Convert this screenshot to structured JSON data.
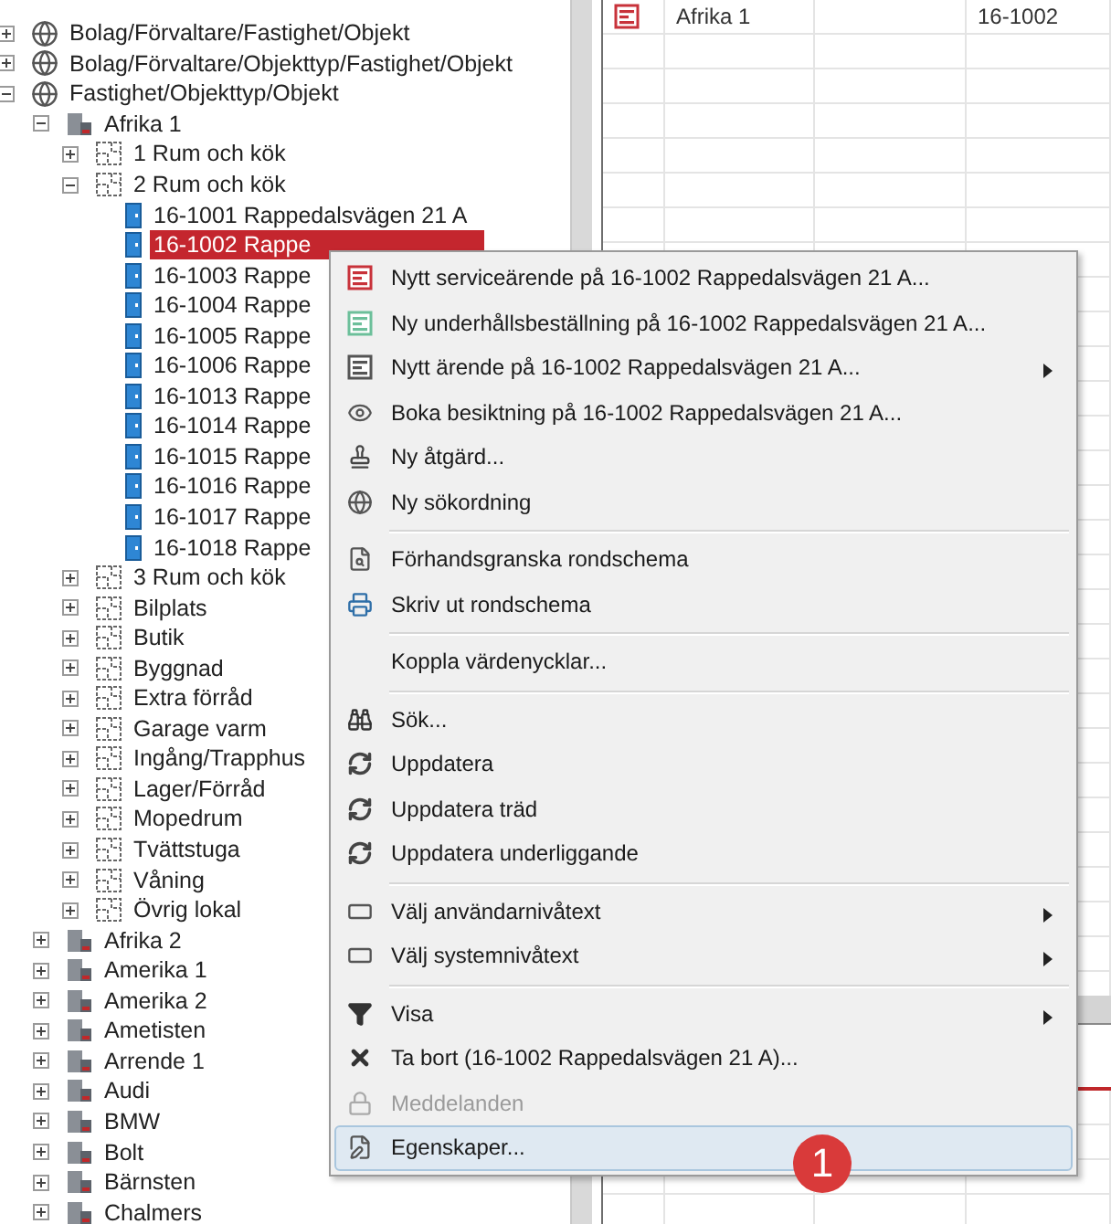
{
  "tree": [
    {
      "label": "Bolag/Förvaltare/Fastighet/Objekt",
      "kind": "query",
      "expanded": false
    },
    {
      "label": "Bolag/Förvaltare/Objekttyp/Fastighet/Objekt",
      "kind": "query",
      "expanded": false
    },
    {
      "label": "Fastighet/Objekttyp/Objekt",
      "kind": "query",
      "expanded": true,
      "children": [
        {
          "label": "Afrika 1",
          "kind": "property",
          "expanded": true,
          "children": [
            {
              "label": "1 Rum och kök",
              "kind": "objecttype",
              "expanded": false
            },
            {
              "label": "2 Rum och kök",
              "kind": "objecttype",
              "expanded": true,
              "children": [
                {
                  "label": "16-1001 Rappedalsvägen 21 A",
                  "kind": "unit",
                  "selected": false
                },
                {
                  "label": "16-1002 Rappe",
                  "kind": "unit",
                  "selected": true
                },
                {
                  "label": "16-1003 Rappe",
                  "kind": "unit",
                  "selected": false
                },
                {
                  "label": "16-1004 Rappe",
                  "kind": "unit",
                  "selected": false
                },
                {
                  "label": "16-1005 Rappe",
                  "kind": "unit",
                  "selected": false
                },
                {
                  "label": "16-1006 Rappe",
                  "kind": "unit",
                  "selected": false
                },
                {
                  "label": "16-1013 Rappe",
                  "kind": "unit",
                  "selected": false
                },
                {
                  "label": "16-1014 Rappe",
                  "kind": "unit",
                  "selected": false
                },
                {
                  "label": "16-1015 Rappe",
                  "kind": "unit",
                  "selected": false
                },
                {
                  "label": "16-1016 Rappe",
                  "kind": "unit",
                  "selected": false
                },
                {
                  "label": "16-1017 Rappe",
                  "kind": "unit",
                  "selected": false
                },
                {
                  "label": "16-1018 Rappe",
                  "kind": "unit",
                  "selected": false
                }
              ]
            },
            {
              "label": "3 Rum och kök",
              "kind": "objecttype",
              "expanded": false
            },
            {
              "label": "Bilplats",
              "kind": "objecttype",
              "expanded": false
            },
            {
              "label": "Butik",
              "kind": "objecttype",
              "expanded": false
            },
            {
              "label": "Byggnad",
              "kind": "objecttype",
              "expanded": false
            },
            {
              "label": "Extra förråd",
              "kind": "objecttype",
              "expanded": false
            },
            {
              "label": "Garage varm",
              "kind": "objecttype",
              "expanded": false
            },
            {
              "label": "Ingång/Trapphus",
              "kind": "objecttype",
              "expanded": false
            },
            {
              "label": "Lager/Förråd",
              "kind": "objecttype",
              "expanded": false
            },
            {
              "label": "Mopedrum",
              "kind": "objecttype",
              "expanded": false
            },
            {
              "label": "Tvättstuga",
              "kind": "objecttype",
              "expanded": false
            },
            {
              "label": "Våning",
              "kind": "objecttype",
              "expanded": false
            },
            {
              "label": "Övrig lokal",
              "kind": "objecttype",
              "expanded": false
            }
          ]
        },
        {
          "label": "Afrika 2",
          "kind": "property",
          "expanded": false
        },
        {
          "label": "Amerika 1",
          "kind": "property",
          "expanded": false
        },
        {
          "label": "Amerika 2",
          "kind": "property",
          "expanded": false
        },
        {
          "label": "Ametisten",
          "kind": "property",
          "expanded": false
        },
        {
          "label": "Arrende 1",
          "kind": "property",
          "expanded": false
        },
        {
          "label": "Audi",
          "kind": "property",
          "expanded": false
        },
        {
          "label": "BMW",
          "kind": "property",
          "expanded": false
        },
        {
          "label": "Bolt",
          "kind": "property",
          "expanded": false
        },
        {
          "label": "Bärnsten",
          "kind": "property",
          "expanded": false
        },
        {
          "label": "Chalmers",
          "kind": "property",
          "expanded": false
        }
      ]
    }
  ],
  "grid": {
    "rows": [
      {
        "name": "Afrika 1",
        "number": "16-1002"
      }
    ]
  },
  "context_menu": {
    "items": [
      {
        "kind": "item",
        "label": "Nytt serviceärende på 16-1002 Rappedalsvägen 21 A...",
        "submenu": false,
        "disabled": false,
        "selected": false
      },
      {
        "kind": "item",
        "label": "Ny underhållsbeställning på 16-1002 Rappedalsvägen 21 A...",
        "submenu": false,
        "disabled": false,
        "selected": false
      },
      {
        "kind": "item",
        "label": "Nytt ärende på 16-1002 Rappedalsvägen 21 A...",
        "submenu": true,
        "disabled": false,
        "selected": false
      },
      {
        "kind": "item",
        "label": "Boka besiktning på 16-1002 Rappedalsvägen 21 A...",
        "submenu": false,
        "disabled": false,
        "selected": false
      },
      {
        "kind": "item",
        "label": "Ny åtgärd...",
        "submenu": false,
        "disabled": false,
        "selected": false
      },
      {
        "kind": "item",
        "label": "Ny sökordning",
        "submenu": false,
        "disabled": false,
        "selected": false
      },
      {
        "kind": "separator"
      },
      {
        "kind": "item",
        "label": "Förhandsgranska rondschema",
        "submenu": false,
        "disabled": false,
        "selected": false
      },
      {
        "kind": "item",
        "label": "Skriv ut rondschema",
        "submenu": false,
        "disabled": false,
        "selected": false
      },
      {
        "kind": "separator"
      },
      {
        "kind": "item",
        "label": "Koppla värdenycklar...",
        "submenu": false,
        "disabled": false,
        "selected": false
      },
      {
        "kind": "separator"
      },
      {
        "kind": "item",
        "label": "Sök...",
        "submenu": false,
        "disabled": false,
        "selected": false
      },
      {
        "kind": "item",
        "label": "Uppdatera",
        "submenu": false,
        "disabled": false,
        "selected": false
      },
      {
        "kind": "item",
        "label": "Uppdatera träd",
        "submenu": false,
        "disabled": false,
        "selected": false
      },
      {
        "kind": "item",
        "label": "Uppdatera underliggande",
        "submenu": false,
        "disabled": false,
        "selected": false
      },
      {
        "kind": "separator"
      },
      {
        "kind": "item",
        "label": "Välj användarnivåtext",
        "submenu": true,
        "disabled": false,
        "selected": false
      },
      {
        "kind": "item",
        "label": "Välj systemnivåtext",
        "submenu": true,
        "disabled": false,
        "selected": false
      },
      {
        "kind": "separator"
      },
      {
        "kind": "item",
        "label": "Visa",
        "submenu": true,
        "disabled": false,
        "selected": false
      },
      {
        "kind": "item",
        "label": "Ta bort (16-1002 Rappedalsvägen 21 A)...",
        "submenu": false,
        "disabled": false,
        "selected": false
      },
      {
        "kind": "item",
        "label": "Meddelanden",
        "submenu": false,
        "disabled": true,
        "selected": false
      },
      {
        "kind": "item",
        "label": "Egenskaper...",
        "submenu": false,
        "disabled": false,
        "selected": true
      }
    ]
  },
  "step_badge": "1"
}
